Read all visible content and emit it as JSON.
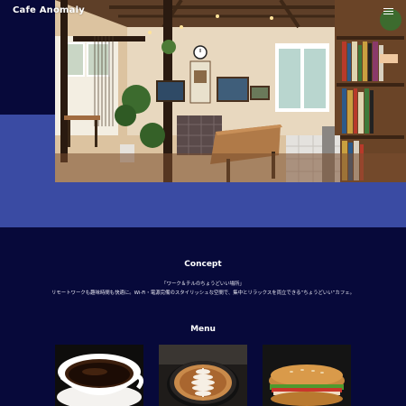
{
  "header": {
    "logo_text": "Cafe Anomaly",
    "menu_icon": "hamburger-icon"
  },
  "hero": {
    "band_color": "#3a4ba3",
    "image_subject": "cafe-interior-photo"
  },
  "concept": {
    "title": "Concept",
    "tagline": "「ワーク＆チルのちょうどいい場所」",
    "description": "リモートワークも趣味時間も快適に。Wi-Fi・電源完備のスタイリッシュな空間で、集中とリラックスを両立できる“ちょうどいい”カフェ。"
  },
  "menu": {
    "title": "Menu",
    "items": [
      {
        "image_subject": "black-coffee-cup-photo"
      },
      {
        "image_subject": "latte-art-photo"
      },
      {
        "image_subject": "sandwich-photo"
      }
    ]
  },
  "colors": {
    "background": "#07093a",
    "accent_band": "#3a4ba3",
    "text": "#ffffff"
  }
}
